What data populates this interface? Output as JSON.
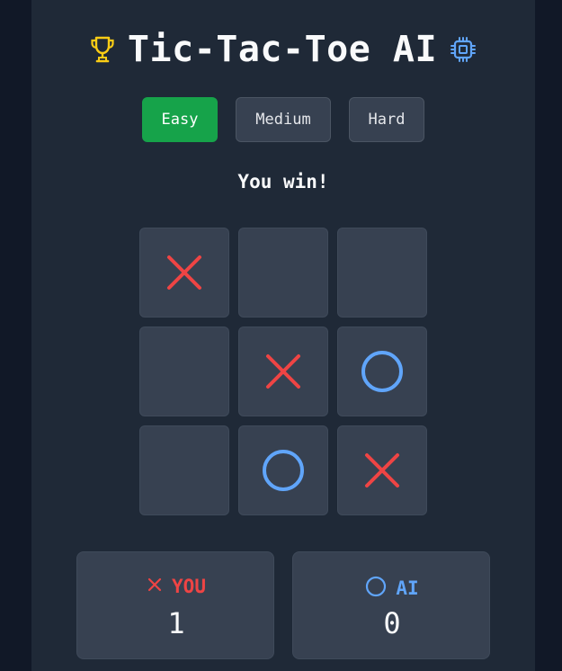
{
  "header": {
    "title": "Tic-Tac-Toe AI",
    "left_icon": "trophy-icon",
    "right_icon": "chip-icon"
  },
  "difficulty": {
    "options": [
      "Easy",
      "Medium",
      "Hard"
    ],
    "selected": "Easy"
  },
  "status": "You win!",
  "board": {
    "cells": [
      "X",
      "",
      "",
      "",
      "X",
      "O",
      "",
      "O",
      "X"
    ]
  },
  "scores": {
    "player": {
      "label": "YOU",
      "value": "1",
      "icon": "x-icon"
    },
    "ai": {
      "label": "AI",
      "value": "0",
      "icon": "o-icon"
    }
  },
  "colors": {
    "x": "#ef4444",
    "o": "#60a5fa",
    "trophy": "#facc15",
    "active_button": "#16a34a",
    "panel": "#1f2937",
    "cell": "#374151"
  }
}
